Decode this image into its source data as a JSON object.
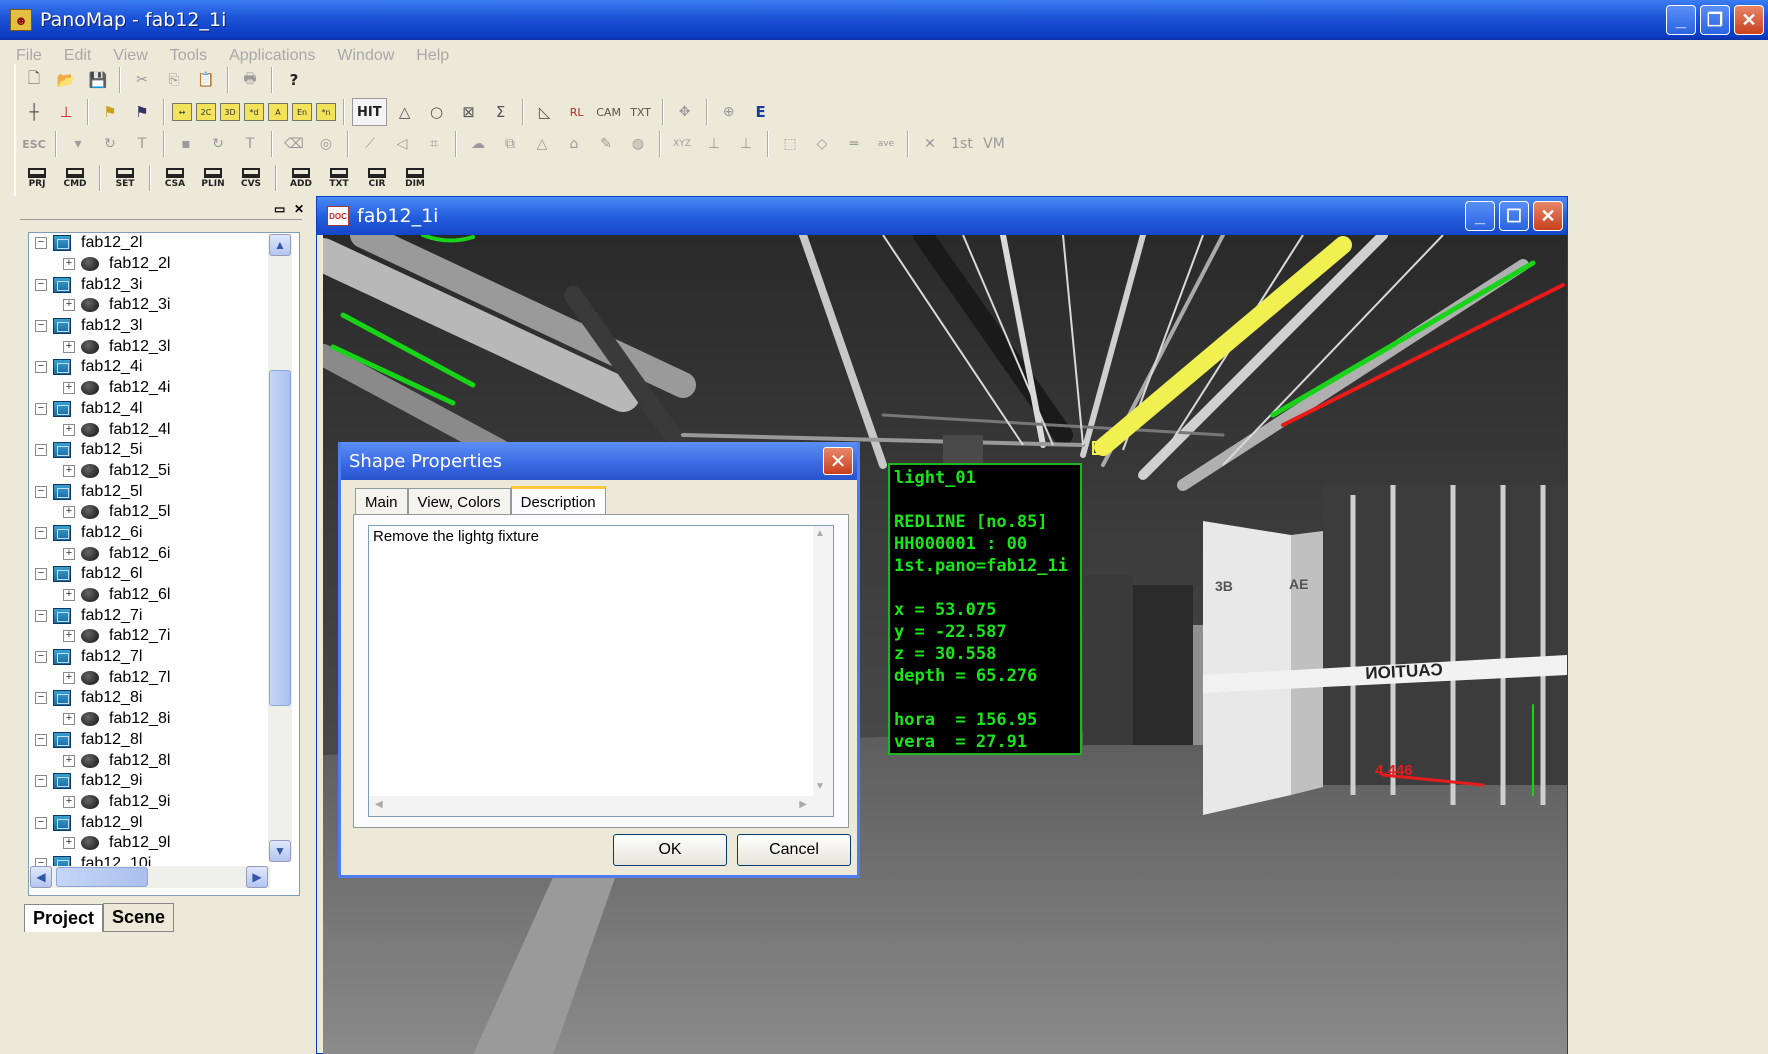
{
  "window": {
    "title": "PanoMap - fab12_1i"
  },
  "menu": [
    "File",
    "Edit",
    "View",
    "Tools",
    "Applications",
    "Window",
    "Help"
  ],
  "toolbar": {
    "hit_label": "HIT",
    "esc_label": "ESC",
    "first_label": "1st",
    "vm_label": "VM",
    "cmd_buttons": [
      "PRJ",
      "CMD",
      "SET",
      "CSA",
      "PLIN",
      "CVS",
      "ADD",
      "TXT",
      "CIR",
      "DIM"
    ]
  },
  "tree": {
    "items": [
      {
        "label": "fab12_2l",
        "child": "fab12_2l"
      },
      {
        "label": "fab12_3i",
        "child": "fab12_3i"
      },
      {
        "label": "fab12_3l",
        "child": "fab12_3l"
      },
      {
        "label": "fab12_4i",
        "child": "fab12_4i"
      },
      {
        "label": "fab12_4l",
        "child": "fab12_4l"
      },
      {
        "label": "fab12_5i",
        "child": "fab12_5i"
      },
      {
        "label": "fab12_5l",
        "child": "fab12_5l"
      },
      {
        "label": "fab12_6i",
        "child": "fab12_6i"
      },
      {
        "label": "fab12_6l",
        "child": "fab12_6l"
      },
      {
        "label": "fab12_7i",
        "child": "fab12_7i"
      },
      {
        "label": "fab12_7l",
        "child": "fab12_7l"
      },
      {
        "label": "fab12_8i",
        "child": "fab12_8i"
      },
      {
        "label": "fab12_8l",
        "child": "fab12_8l"
      },
      {
        "label": "fab12_9i",
        "child": "fab12_9i"
      },
      {
        "label": "fab12_9l",
        "child": "fab12_9l"
      }
    ],
    "partial_last": "fab12_10i"
  },
  "panel_tabs": {
    "project": "Project",
    "scene": "Scene"
  },
  "document": {
    "title": "fab12_1i"
  },
  "info": {
    "name": "light_01",
    "redline": "REDLINE [no.85]",
    "id": "HH000001 : 00",
    "pano": "1st.pano=fab12_1i",
    "x": "x = 53.075",
    "y": "y = -22.587",
    "z": "z = 30.558",
    "depth": "depth = 65.276",
    "hora": "hora  = 156.95",
    "vera": "vera  = 27.91"
  },
  "scene_text": {
    "col1": "3B",
    "col2": "AE",
    "caution": "CAUTION",
    "measure": "4.446"
  },
  "dialog": {
    "title": "Shape Properties",
    "tabs": [
      "Main",
      "View, Colors",
      "Description"
    ],
    "selected_tab": "Description",
    "description": "Remove the lightg fixture",
    "ok": "OK",
    "cancel": "Cancel"
  },
  "colors": {
    "titlebar": "#0a3cc4",
    "info_text": "#19e619",
    "redline": "#ff2020",
    "highlight": "#f0f050"
  }
}
